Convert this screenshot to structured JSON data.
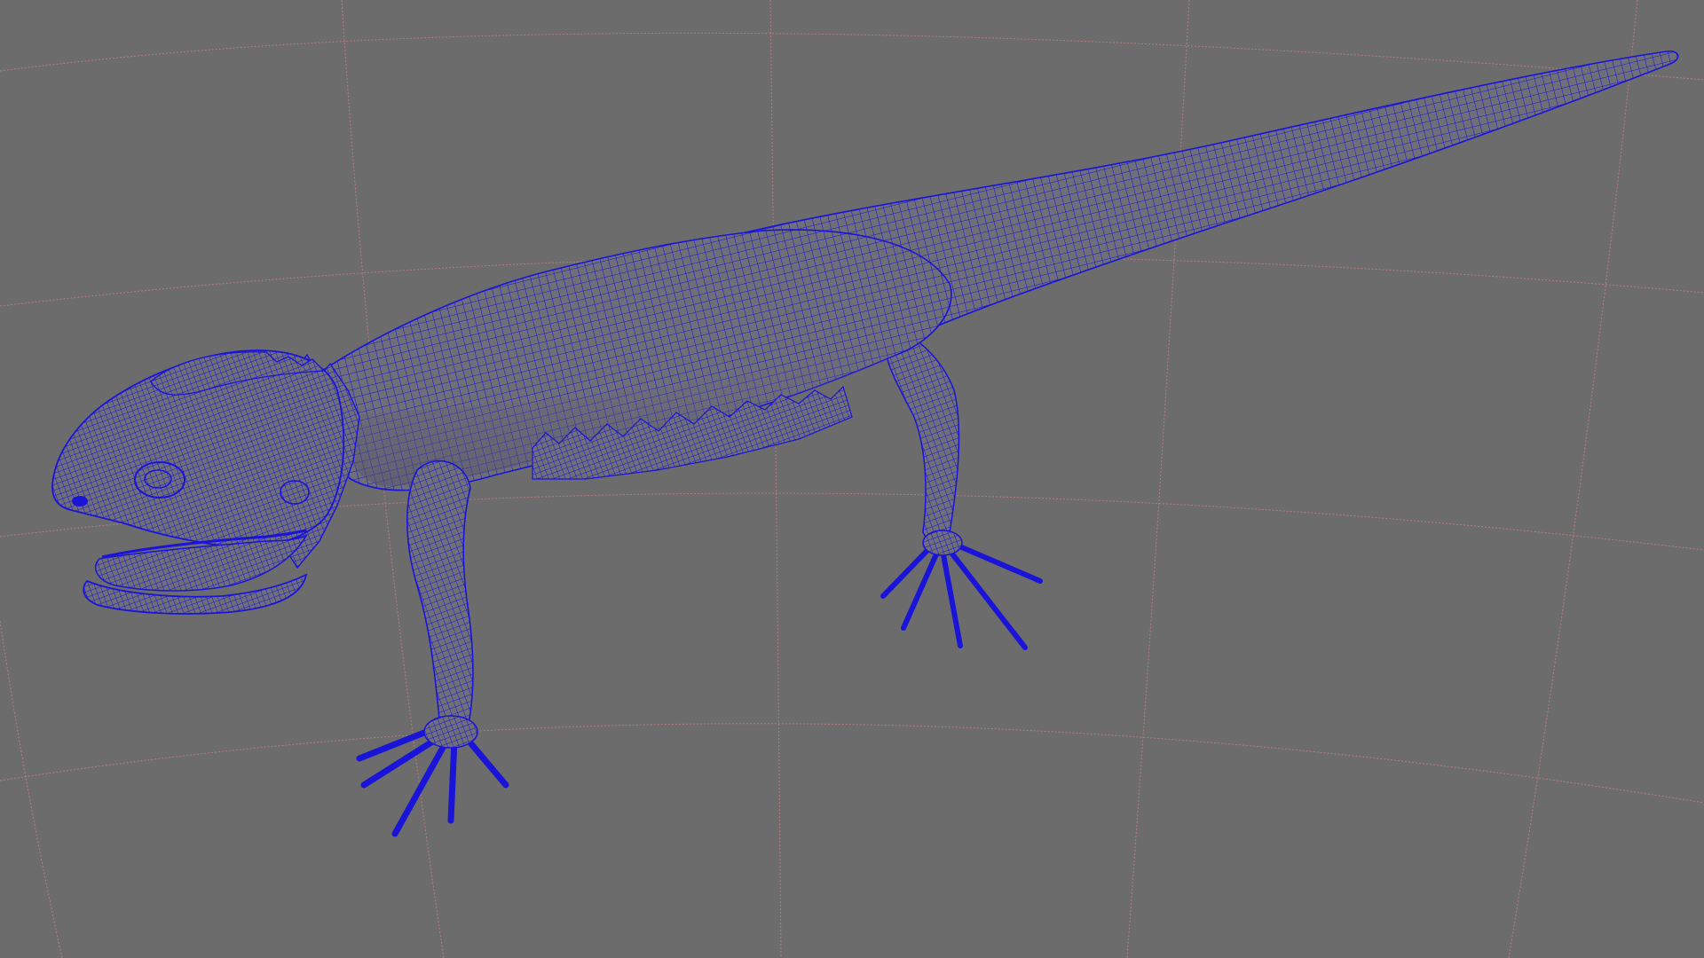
{
  "viewport": {
    "name": "perspective-viewport",
    "background_color": "#6c6c6c",
    "grid_color": "#b77b80",
    "wire_color": "#1a14d8",
    "shade_color": "#6f6f78",
    "shade_dark_color": "#54546a",
    "model": {
      "subject": "lizard",
      "display_mode": "wireframe-on-shaded"
    }
  }
}
